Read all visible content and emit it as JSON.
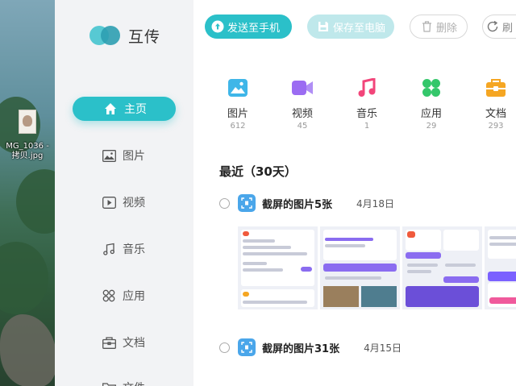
{
  "desktop": {
    "file_name": "MG_1036 - 拷贝.jpg"
  },
  "app": {
    "name": "互传"
  },
  "sidebar": {
    "items": [
      {
        "label": "主页",
        "icon": "home-icon",
        "active": true
      },
      {
        "label": "图片",
        "icon": "image-icon"
      },
      {
        "label": "视频",
        "icon": "video-icon"
      },
      {
        "label": "音乐",
        "icon": "music-icon"
      },
      {
        "label": "应用",
        "icon": "apps-icon"
      },
      {
        "label": "文档",
        "icon": "document-icon"
      },
      {
        "label": "文件",
        "icon": "folder-icon"
      }
    ]
  },
  "toolbar": {
    "send_label": "发送至手机",
    "save_label": "保存至电脑",
    "delete_label": "删除",
    "refresh_label": "刷"
  },
  "categories": [
    {
      "label": "图片",
      "count": "612",
      "icon": "image-icon",
      "color": "#3fb6e8"
    },
    {
      "label": "视频",
      "count": "45",
      "icon": "video-icon",
      "color": "#9b6cf2"
    },
    {
      "label": "音乐",
      "count": "1",
      "icon": "music-icon",
      "color": "#f2457a"
    },
    {
      "label": "应用",
      "count": "29",
      "icon": "apps-icon",
      "color": "#34c76b"
    },
    {
      "label": "文档",
      "count": "293",
      "icon": "document-icon",
      "color": "#f5a623"
    }
  ],
  "recent": {
    "title": "最近（30天）",
    "groups": [
      {
        "title": "截屏的图片5张",
        "date": "4月18日"
      },
      {
        "title": "截屏的图片31张",
        "date": "4月15日"
      }
    ]
  },
  "colors": {
    "accent": "#2bc0c9",
    "accent_light": "#bfe8eb",
    "sidebar_bg": "#f2f3f5"
  }
}
